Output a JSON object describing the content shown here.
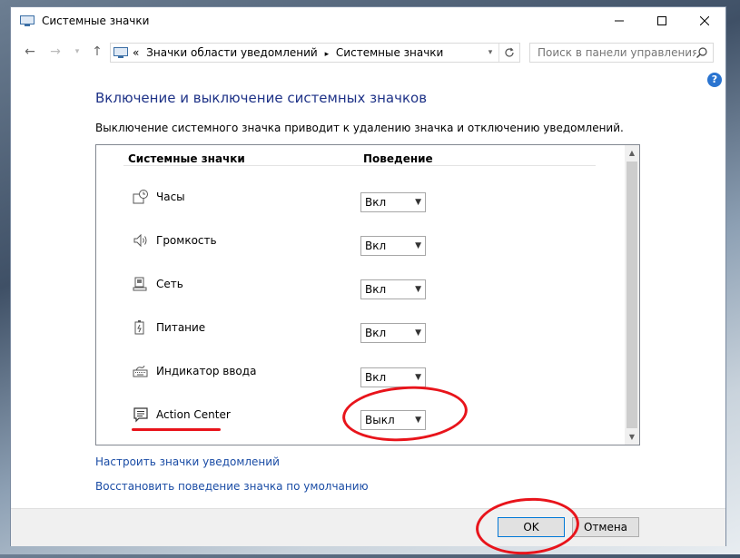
{
  "window": {
    "title": "Системные значки"
  },
  "breadcrumb": {
    "prefix": "«",
    "items": [
      "Значки области уведомлений",
      "Системные значки"
    ]
  },
  "search": {
    "placeholder": "Поиск в панели управления"
  },
  "help": {
    "label": "?"
  },
  "page": {
    "heading": "Включение и выключение системных значков",
    "description": "Выключение системного значка приводит к удалению значка и отключению уведомлений."
  },
  "table": {
    "columns": [
      "Системные значки",
      "Поведение"
    ],
    "rows": [
      {
        "label": "Часы",
        "icon": "clock-icon",
        "value": "Вкл"
      },
      {
        "label": "Громкость",
        "icon": "volume-icon",
        "value": "Вкл"
      },
      {
        "label": "Сеть",
        "icon": "network-icon",
        "value": "Вкл"
      },
      {
        "label": "Питание",
        "icon": "power-icon",
        "value": "Вкл"
      },
      {
        "label": "Индикатор ввода",
        "icon": "keyboard-icon",
        "value": "Вкл"
      },
      {
        "label": "Action Center",
        "icon": "action-center-icon",
        "value": "Выкл"
      }
    ]
  },
  "links": {
    "customize": "Настроить значки уведомлений",
    "restore": "Восстановить поведение значка по умолчанию"
  },
  "buttons": {
    "ok": "OK",
    "cancel": "Отмена"
  },
  "colors": {
    "heading": "#1e3287",
    "link": "#1a4ca5",
    "annotation": "#e8141b",
    "accent": "#0078d7"
  }
}
